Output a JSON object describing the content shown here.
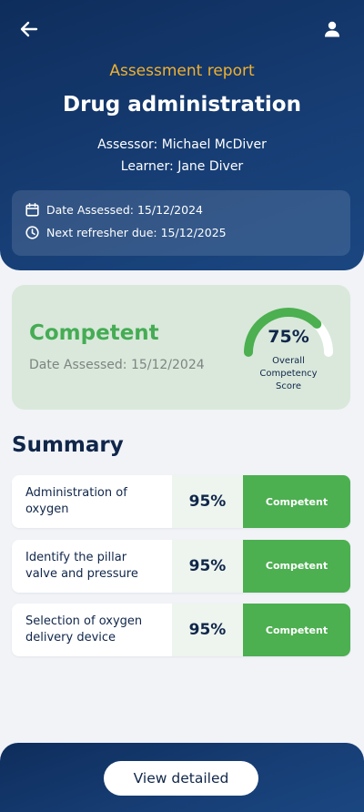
{
  "header": {
    "kicker": "Assessment report",
    "title": "Drug administration",
    "assessor": "Assessor: Michael McDiver",
    "learner": "Learner: Jane Diver",
    "date_assessed": "Date Assessed: 15/12/2024",
    "next_refresher": "Next refresher due: 15/12/2025",
    "back_icon": "arrow-left-icon",
    "user_icon": "user-icon",
    "calendar_icon": "calendar-icon",
    "clock_icon": "clock-icon"
  },
  "result": {
    "status": "Competent",
    "date_assessed": "Date Assessed: 15/12/2024",
    "score_label": "75%",
    "score_fraction": 0.75,
    "caption": "Overall Competency Score",
    "gauge_color": "#4caf50",
    "gauge_track_color": "#ffffff",
    "status_color": "#45ac54"
  },
  "summary": {
    "heading": "Summary",
    "rows": [
      {
        "label": "Administration of oxygen",
        "score": "95%",
        "status": "Competent"
      },
      {
        "label": "Identify the pillar valve and pressure",
        "score": "95%",
        "status": "Competent"
      },
      {
        "label": "Selection of oxygen delivery device",
        "score": "95%",
        "status": "Competent"
      }
    ]
  },
  "footer": {
    "button_label": "View detailed"
  },
  "colors": {
    "header_bg": "#173e75",
    "accent": "#f0b12f",
    "competent_green": "#4caf50"
  }
}
